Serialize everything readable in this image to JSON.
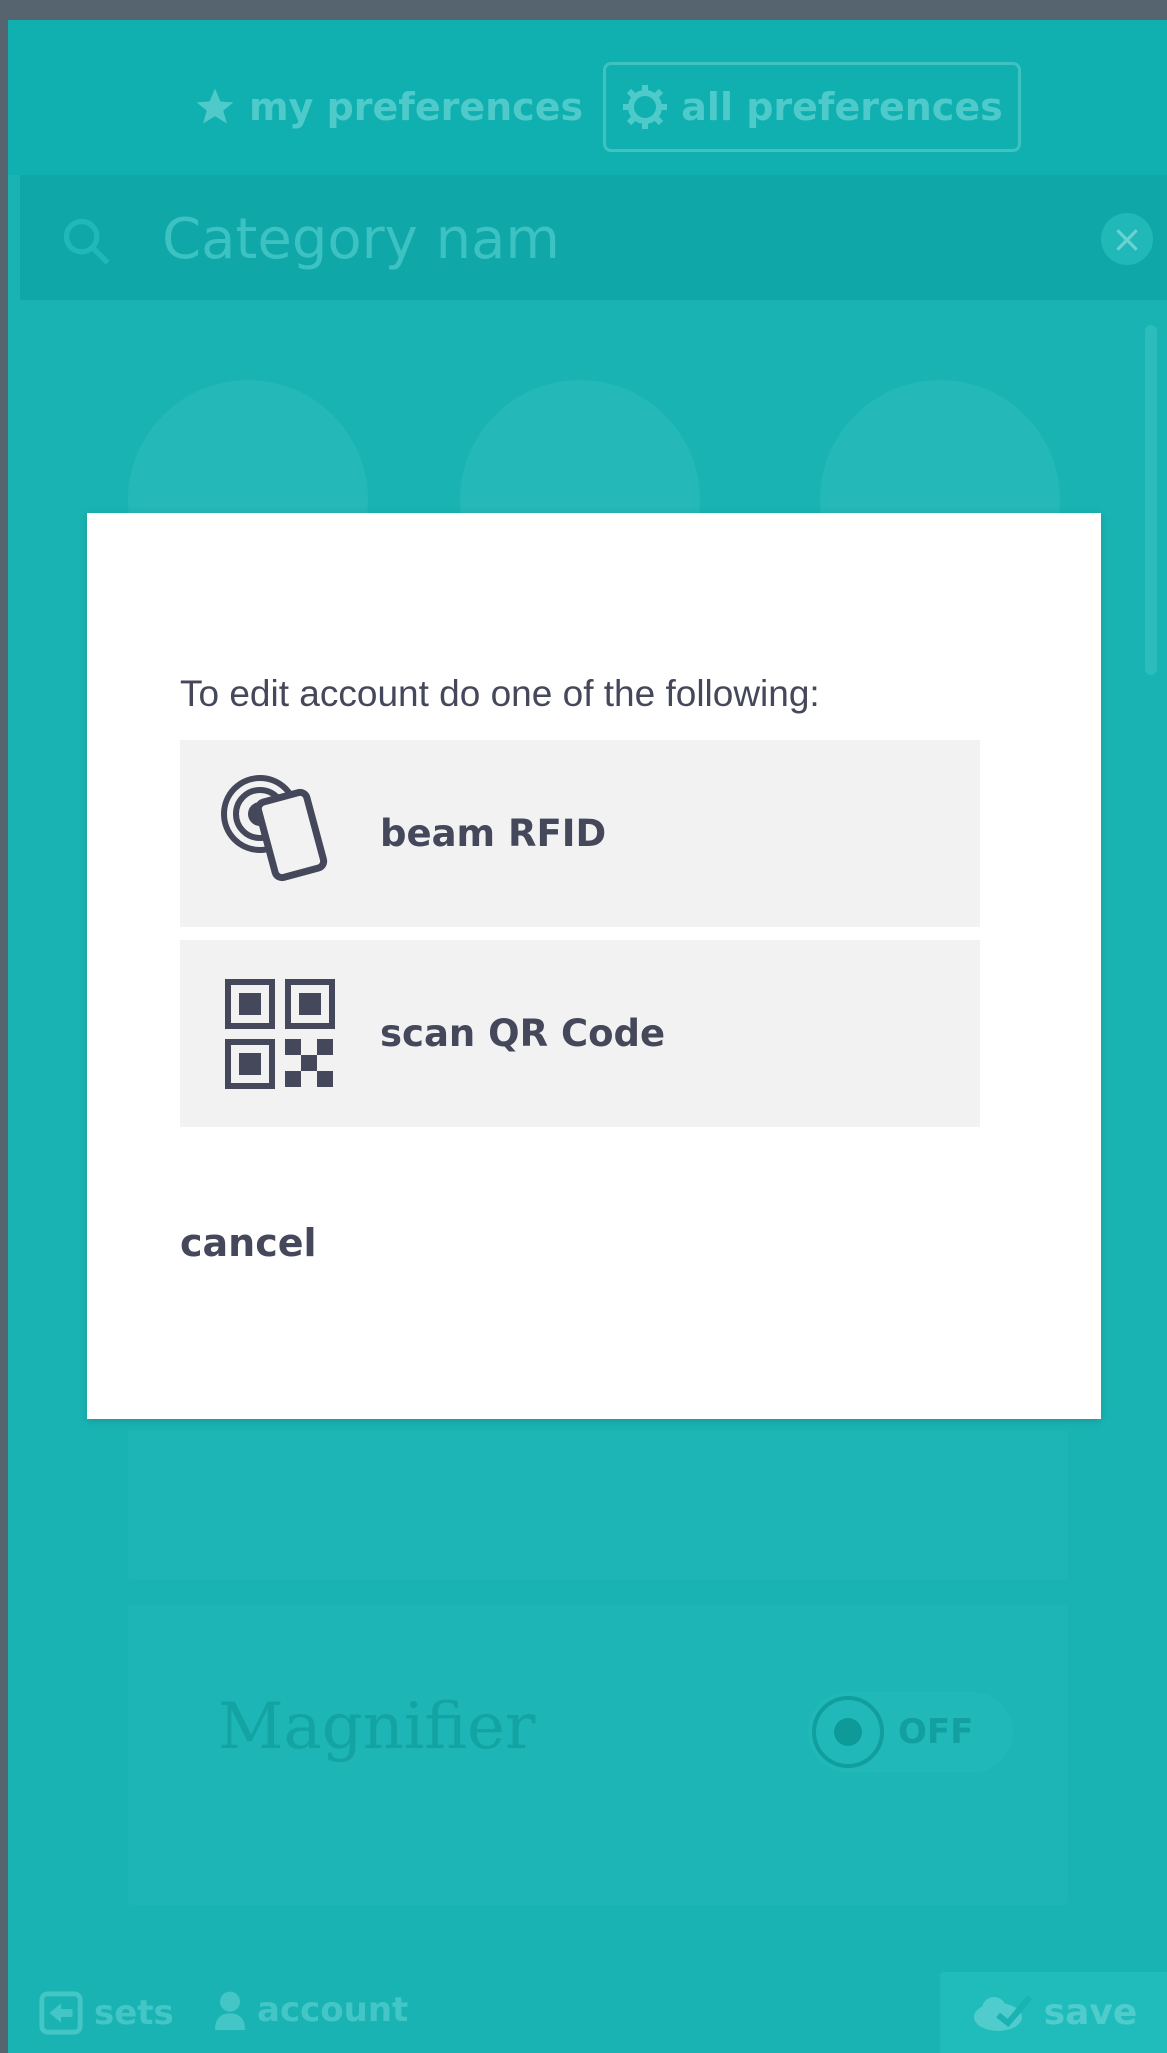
{
  "header": {
    "tabs": [
      {
        "label": "my preferences",
        "icon": "star-icon"
      },
      {
        "label": "all preferences",
        "icon": "gear-icon"
      }
    ]
  },
  "search": {
    "placeholder": "Category name",
    "clear_icon": "close-icon"
  },
  "background": {
    "setting_title": "Magnifier",
    "toggle_state": "OFF"
  },
  "footer": {
    "sets_label": "sets",
    "account_label": "account",
    "save_label": "save"
  },
  "dialog": {
    "heading": "To edit account do one of the following:",
    "options": [
      {
        "label": "beam RFID",
        "icon": "rfid-card-icon"
      },
      {
        "label": "scan QR Code",
        "icon": "qr-code-icon"
      }
    ],
    "cancel_label": "cancel"
  },
  "colors": {
    "teal": "#1ab3b3",
    "dialog_text": "#45475a",
    "option_bg": "#f2f2f2"
  }
}
